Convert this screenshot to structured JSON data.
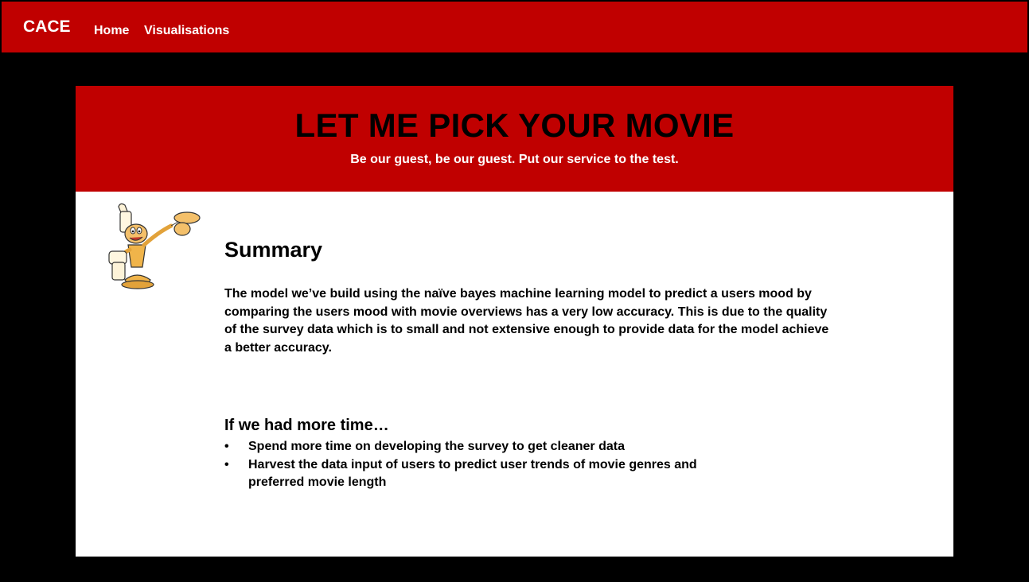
{
  "navbar": {
    "brand": "CACE",
    "links": [
      "Home",
      "Visualisations"
    ]
  },
  "hero": {
    "title": "LET ME PICK YOUR MOVIE",
    "subtitle": "Be our guest, be our guest. Put our service to the test."
  },
  "summary": {
    "heading": "Summary",
    "text": "The model we’ve build using the naïve bayes machine learning model to predict a users mood by comparing the users mood with movie overviews has a very low accuracy. This is due to the quality of the survey data which is to small and not extensive enough to provide data for the model achieve a better accuracy."
  },
  "more_time": {
    "heading": "If we had more time…",
    "items": [
      "Spend more time on developing the survey to get cleaner data",
      "Harvest the data input of users to predict user trends of movie genres and preferred movie length"
    ],
    "bullet": "•"
  },
  "colors": {
    "accent": "#c00000",
    "background": "#000000",
    "card": "#ffffff"
  }
}
